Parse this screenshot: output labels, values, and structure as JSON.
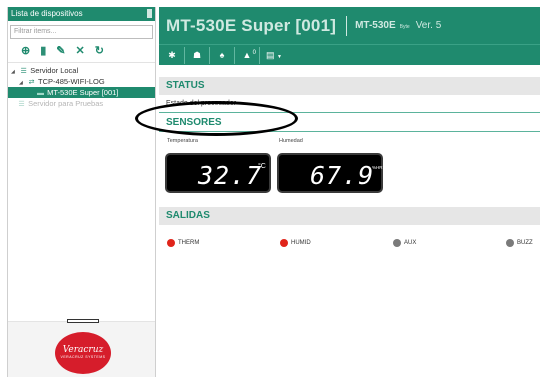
{
  "sidebar": {
    "header": "Lista de dispositivos",
    "filter_placeholder": "Filtrar items...",
    "tools": [
      {
        "icon": "plus-circle-icon"
      },
      {
        "icon": "trash-icon"
      },
      {
        "icon": "pencil-icon"
      },
      {
        "icon": "tools-icon"
      },
      {
        "icon": "refresh-icon"
      }
    ],
    "tree": [
      {
        "label": "Servidor Local",
        "icon": "server-icon"
      },
      {
        "label": "TCP-485-WIFI-LOG",
        "icon": "network-icon"
      },
      {
        "label": "MT-530E Super [001]",
        "icon": "device-icon",
        "selected": true
      },
      {
        "label": "Servidor para Pruebas",
        "icon": "server-icon",
        "dim": true
      }
    ],
    "logo": {
      "text": "Veracruz",
      "sub": "VERACRUZ SYSTEMS"
    }
  },
  "device": {
    "title": "MT-530E Super [001]",
    "model": "MT-530E",
    "byte": "Byte",
    "version": "Ver. 5"
  },
  "toolbar": {
    "buttons": [
      {
        "icon": "gear-icon"
      },
      {
        "icon": "users-icon"
      },
      {
        "icon": "bell-icon"
      },
      {
        "icon": "warning-icon",
        "badge": "0"
      },
      {
        "icon": "document-icon"
      }
    ]
  },
  "status": {
    "title": "STATUS",
    "text": "Estado del procesador"
  },
  "sensors": {
    "title": "SENSORES",
    "temperature": {
      "label": "Temperatura",
      "value": "32.7",
      "unit": "°C"
    },
    "humidity": {
      "label": "Humedad",
      "value": "67.9",
      "unit": "%HR"
    }
  },
  "outputs": {
    "title": "SALIDAS",
    "items": [
      {
        "label": "THERM",
        "color": "#e0241a"
      },
      {
        "label": "HUMID",
        "color": "#e0241a"
      },
      {
        "label": "AUX",
        "color": "#7a7a7a"
      },
      {
        "label": "BUZZ",
        "color": "#7a7a7a"
      }
    ]
  },
  "colors": {
    "accent": "#1f8a6e",
    "led_on": "#e0241a",
    "led_off": "#7a7a7a"
  }
}
